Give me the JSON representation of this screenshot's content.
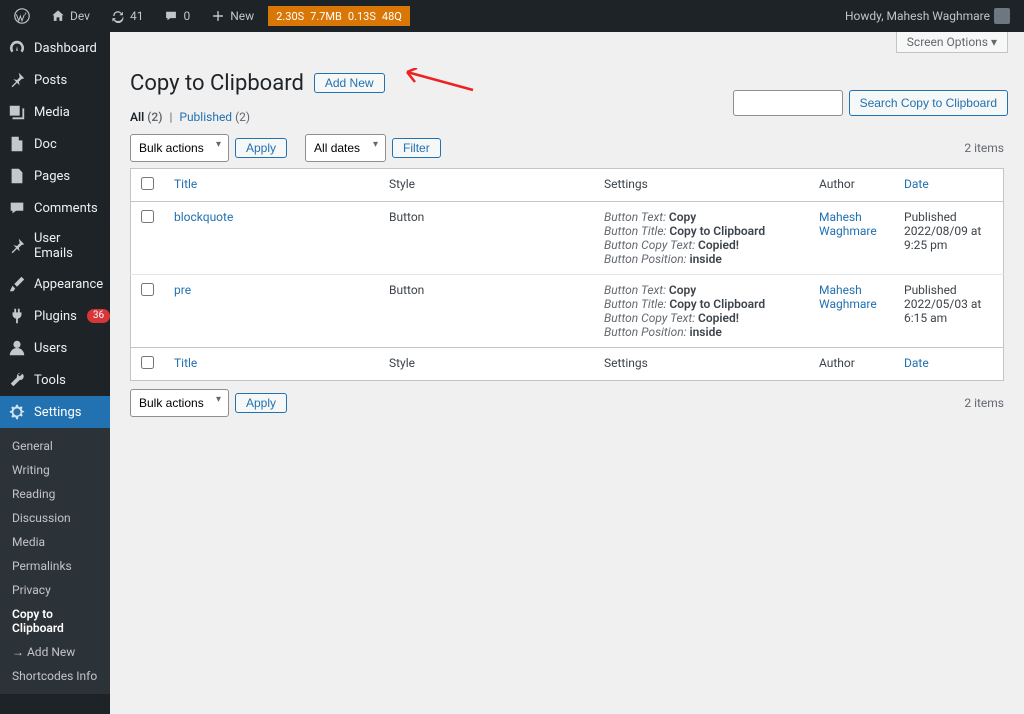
{
  "topbar": {
    "site": "Dev",
    "updates": "41",
    "comments": "0",
    "new": "New",
    "metrics": [
      "2.30S",
      "7.7MB",
      "0.13S",
      "48Q"
    ],
    "howdy": "Howdy, Mahesh Waghmare"
  },
  "sidebar": {
    "items": [
      {
        "label": "Dashboard",
        "icon": "dashboard"
      },
      {
        "label": "Posts",
        "icon": "pin"
      },
      {
        "label": "Media",
        "icon": "media"
      },
      {
        "label": "Doc",
        "icon": "doc"
      },
      {
        "label": "Pages",
        "icon": "page"
      },
      {
        "label": "Comments",
        "icon": "comment"
      },
      {
        "label": "User Emails",
        "icon": "pin"
      },
      {
        "label": "Appearance",
        "icon": "brush"
      },
      {
        "label": "Plugins",
        "icon": "plug",
        "badge": "36"
      },
      {
        "label": "Users",
        "icon": "user"
      },
      {
        "label": "Tools",
        "icon": "wrench"
      },
      {
        "label": "Settings",
        "icon": "gear",
        "active": true
      }
    ],
    "sub": [
      "General",
      "Writing",
      "Reading",
      "Discussion",
      "Media",
      "Permalinks",
      "Privacy",
      "Copy to Clipboard",
      "→ Add New",
      "Shortcodes Info"
    ]
  },
  "page": {
    "title": "Copy to Clipboard",
    "add_new": "Add New",
    "screen_options": "Screen Options ▾"
  },
  "subsub": {
    "all": "All",
    "all_cnt": "(2)",
    "published": "Published",
    "published_cnt": "(2)"
  },
  "filters": {
    "bulk": "Bulk actions",
    "apply": "Apply",
    "dates": "All dates",
    "filter": "Filter",
    "items": "2 items",
    "search_btn": "Search Copy to Clipboard"
  },
  "table": {
    "cols": {
      "title": "Title",
      "style": "Style",
      "settings": "Settings",
      "author": "Author",
      "date": "Date"
    },
    "rows": [
      {
        "title": "blockquote",
        "style": "Button",
        "settings": [
          {
            "k": "Button Text:",
            "v": "Copy"
          },
          {
            "k": "Button Title:",
            "v": "Copy to Clipboard"
          },
          {
            "k": "Button Copy Text:",
            "v": "Copied!"
          },
          {
            "k": "Button Position:",
            "v": "inside"
          }
        ],
        "author": "Mahesh Waghmare",
        "date_status": "Published",
        "date": "2022/08/09 at 9:25 pm"
      },
      {
        "title": "pre",
        "style": "Button",
        "settings": [
          {
            "k": "Button Text:",
            "v": "Copy"
          },
          {
            "k": "Button Title:",
            "v": "Copy to Clipboard"
          },
          {
            "k": "Button Copy Text:",
            "v": "Copied!"
          },
          {
            "k": "Button Position:",
            "v": "inside"
          }
        ],
        "author": "Mahesh Waghmare",
        "date_status": "Published",
        "date": "2022/05/03 at 6:15 am"
      }
    ]
  }
}
